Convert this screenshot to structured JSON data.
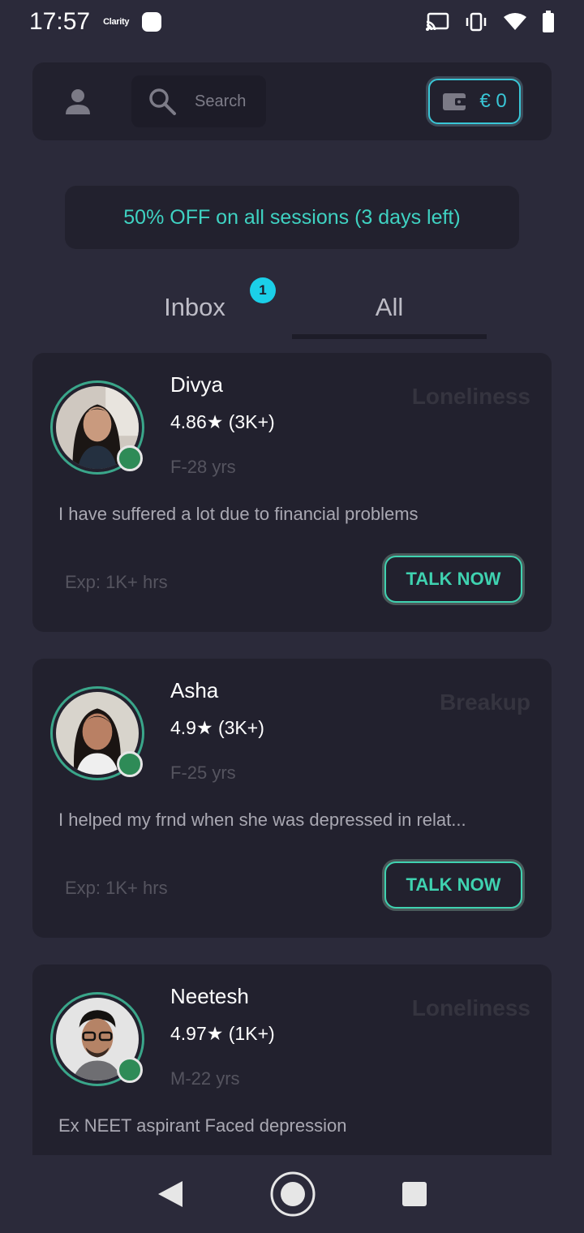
{
  "status_bar": {
    "time": "17:57",
    "app_label": "Clarity"
  },
  "header": {
    "search_placeholder": "Search",
    "wallet_value": "€ 0"
  },
  "promo": {
    "text": "50% OFF on all sessions (3 days left)"
  },
  "tabs": {
    "items": [
      {
        "label": "Inbox"
      },
      {
        "label": "All"
      }
    ],
    "inbox_badge": "1",
    "selected": "All"
  },
  "listeners": [
    {
      "name": "Divya",
      "rating": "4.86★ (3K+)",
      "age": "F-28 yrs",
      "topic": "Loneliness",
      "bio": "I have suffered a lot due to financial problems",
      "experience": "Exp: 1K+ hrs",
      "button": "TALK NOW"
    },
    {
      "name": "Asha",
      "rating": "4.9★ (3K+)",
      "age": "F-25 yrs",
      "topic": "Breakup",
      "bio": "I helped my frnd when she was depressed in relat...",
      "experience": "Exp: 1K+ hrs",
      "button": "TALK NOW"
    },
    {
      "name": "Neetesh",
      "rating": "4.97★ (1K+)",
      "age": "M-22 yrs",
      "topic": "Loneliness",
      "bio": "Ex NEET aspirant Faced depression",
      "experience": "",
      "button": ""
    }
  ],
  "colors": {
    "background": "#2b2a3a",
    "card": "#22212e",
    "accent_cyan": "#39c6d6",
    "accent_green": "#3fd2b0",
    "online": "#2e8b57"
  }
}
